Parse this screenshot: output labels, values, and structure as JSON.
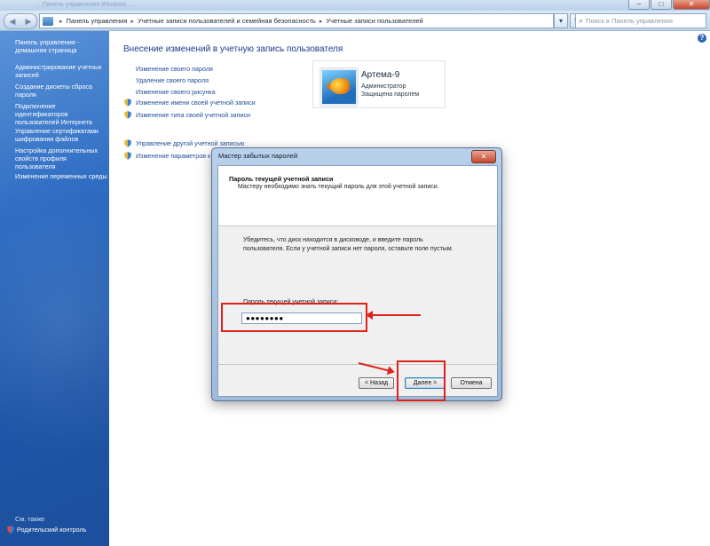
{
  "window": {
    "faint_title": "... Панель управления Windows ...",
    "close_glyph": "✕",
    "minimize_glyph": "–",
    "maximize_glyph": "□"
  },
  "toolbar": {
    "back_glyph": "◀",
    "forward_glyph": "▶",
    "breadcrumb": [
      "Панель управления",
      "Учетные записи пользователей и семейная безопасность",
      "Учетные записи пользователей"
    ],
    "separator": "▸",
    "dropdown_glyph": "▾",
    "refresh_glyph": "↻",
    "search_placeholder": "Поиск в Панель управления",
    "search_icon": "magnifier-icon"
  },
  "sidebar": {
    "home": "Панель управления - домашняя страница",
    "items": [
      "Администрирование учетных записей",
      "Создание дискеты сброса пароля",
      "Подключение идентификаторов пользователей Интернета",
      "Управление сертификатами шифрования файлов",
      "Настройка дополнительных свойств профиля пользователя",
      "Изменение переменных среды"
    ],
    "see_also": "См. также",
    "parental": "Родительский контроль"
  },
  "main": {
    "heading": "Внесение изменений в учетную запись пользователя",
    "help_glyph": "?",
    "tasks": [
      "Изменение своего пароля",
      "Удаление своего пароля",
      "Изменение своего рисунка"
    ],
    "shield_tasks": [
      "Изменение имени своей учетной записи",
      "Изменение типа своей учетной записи"
    ],
    "other_tasks": [
      "Управление другой учетной записью",
      "Изменение параметров к"
    ]
  },
  "account": {
    "name": "Артема-9",
    "role": "Администратор",
    "protection": "Защищена паролем"
  },
  "dialog": {
    "title": "Мастер забытых паролей",
    "header_title": "Пароль текущей учетной записи",
    "header_subtitle": "Мастеру необходимо знать текущий пароль для этой учетной записи.",
    "body": "Убедитесь, что диск находится в дисководе, и введите пароль пользователя. Если у учетной записи нет пароля, оставьте поле пустым.",
    "field_label": "Пароль текущей учетной записи:",
    "field_value": "●●●●●●●●",
    "back": "< Назад",
    "next": "Далее >",
    "cancel": "Отмена"
  },
  "colors": {
    "annotation_red": "#e0201a",
    "link_blue": "#1f4d9b",
    "sidebar_blue": "#2e6cc2"
  }
}
